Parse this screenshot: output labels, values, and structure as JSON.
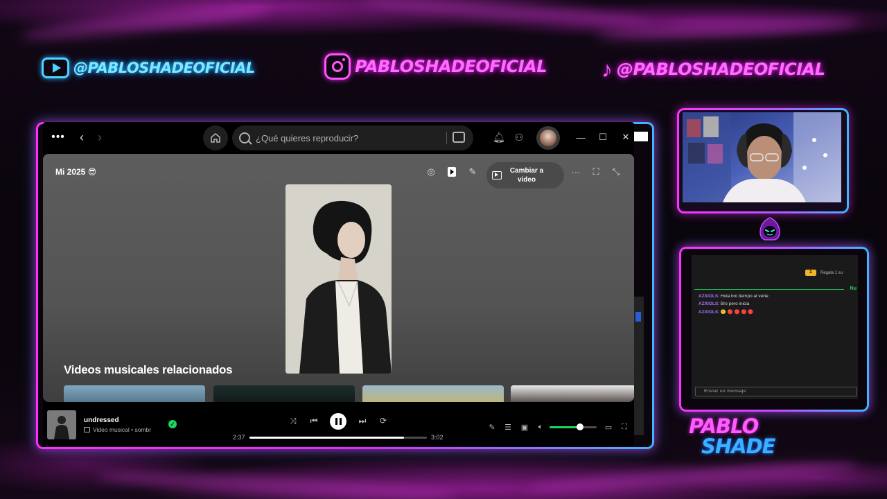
{
  "overlay": {
    "youtube_handle": "@PABLOSHADEOFICIAL",
    "instagram_handle": "PABLOSHADEOFICIAL",
    "tiktok_handle": "@PABLOSHADEOFICIAL",
    "logo_line1": "PABLO",
    "logo_line2": "SHADE",
    "accent_pink": "#ff30ff",
    "accent_blue": "#3ab8ff"
  },
  "spotify": {
    "search_placeholder": "¿Qué quieres reproducir?",
    "view_title": "Mi 2025 😎",
    "switch_video_label": "Cambiar a video",
    "related_title": "Videos musicales relacionados",
    "now_playing": {
      "title": "undressed",
      "subtitle": "Video musical • sombr",
      "elapsed": "2:37",
      "duration": "3:02",
      "progress_fraction": 0.87,
      "volume_fraction": 0.64
    },
    "accent_green": "#1ed760"
  },
  "chat": {
    "gift_label": "Regala 1 su",
    "new_label": "Nu",
    "messages": [
      {
        "user": "AZXIOLS",
        "text": "Hola bro tiempo al verte"
      },
      {
        "user": "AZXIOLS",
        "text": "Bro pero inicia"
      },
      {
        "user": "AZXIOLS",
        "text": "🙂 🔴 🔴 🔴 🔴"
      }
    ],
    "input_placeholder": "Enviar un mensaje"
  }
}
